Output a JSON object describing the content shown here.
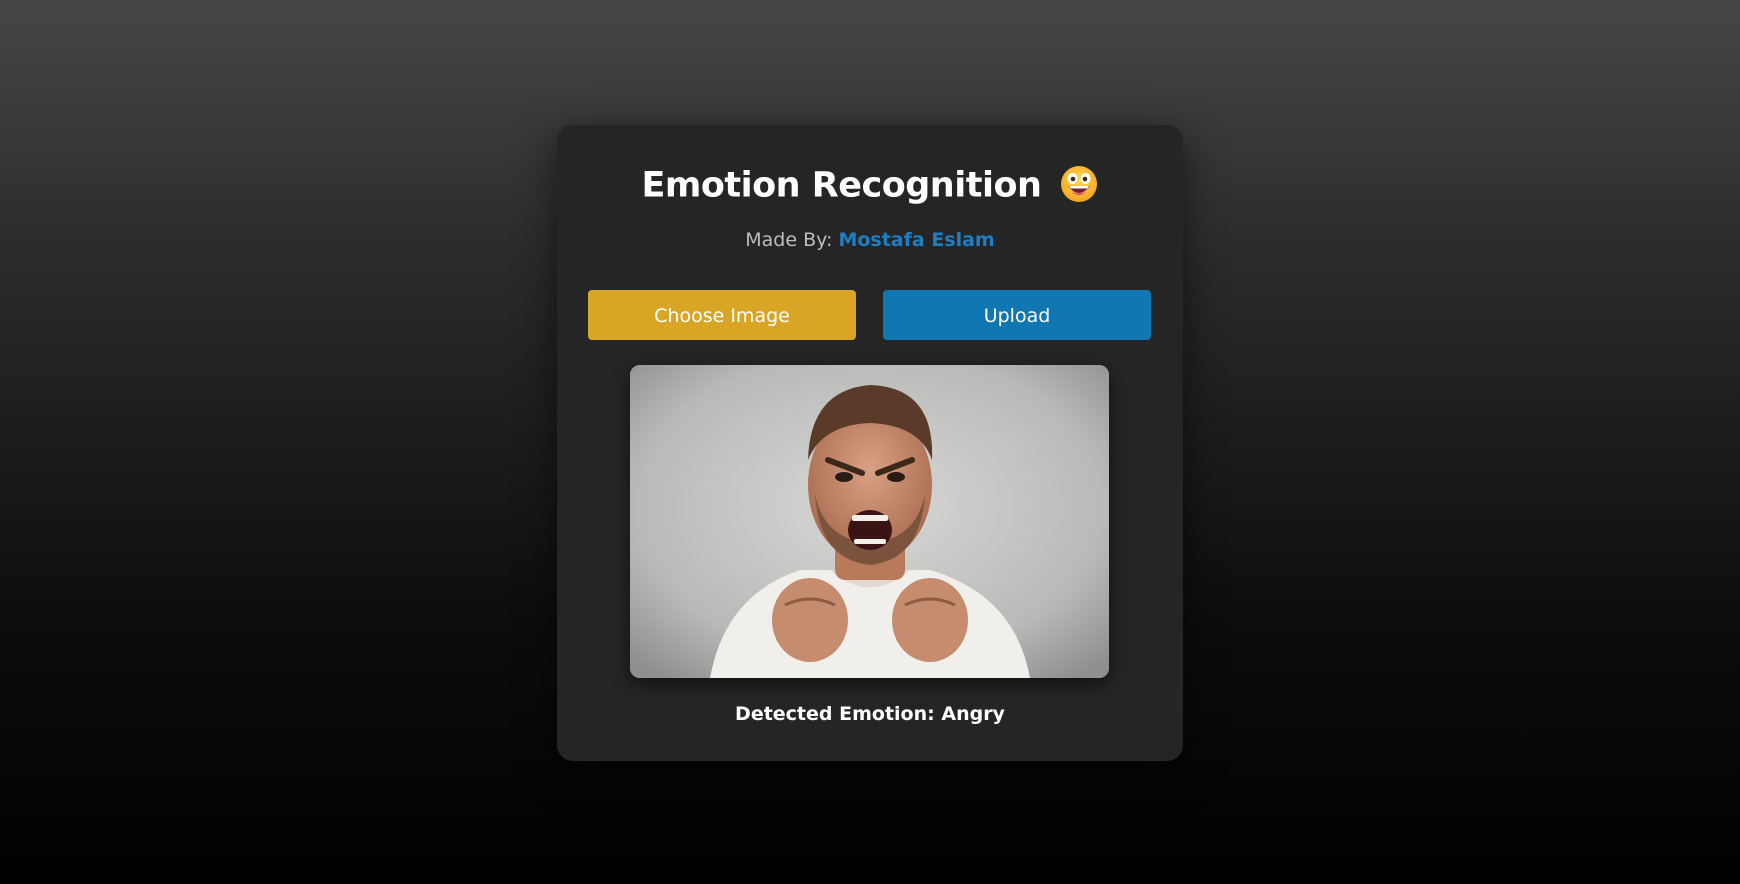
{
  "app": {
    "title": "Emotion Recognition",
    "title_emoji": "grinning-face-emoji"
  },
  "credit": {
    "prefix": "Made By:",
    "author": "Mostafa Eslam"
  },
  "actions": {
    "choose_label": "Choose Image",
    "upload_label": "Upload"
  },
  "preview": {
    "image_description_icon": "uploaded-photo"
  },
  "result": {
    "prefix": "Detected Emotion:",
    "emotion": "Angry"
  },
  "colors": {
    "choose_button": "#d9a525",
    "upload_button": "#1077b2",
    "author_link": "#1f7ec1",
    "card_background": "#252525"
  }
}
